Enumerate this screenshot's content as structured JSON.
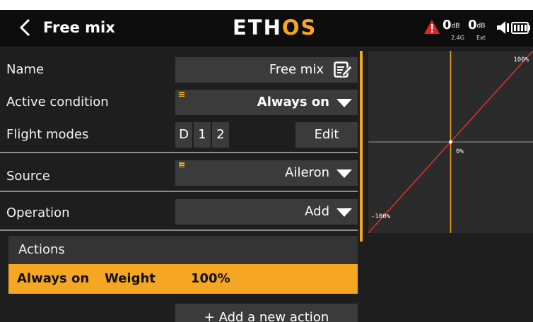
{
  "header": {
    "title": "Free mix",
    "logo_main": "ETH",
    "logo_accent": "OS",
    "rf1_value": "0",
    "rf1_unit": "dB",
    "rf1_band": "2.4G",
    "rf2_value": "0",
    "rf2_unit": "dB",
    "rf2_band": "Ext"
  },
  "form": {
    "name_label": "Name",
    "name_value": "Free mix",
    "active_label": "Active condition",
    "active_value": "Always on",
    "flight_modes_label": "Flight modes",
    "flight_modes": [
      "D",
      "1",
      "2"
    ],
    "edit_label": "Edit",
    "source_label": "Source",
    "source_value": "Aileron",
    "operation_label": "Operation",
    "operation_value": "Add"
  },
  "actions": {
    "header": "Actions",
    "row": {
      "condition": "Always on",
      "weight_label": "Weight",
      "weight_value": "100%"
    },
    "add_label": "+ Add a new action"
  },
  "graph": {
    "top_right_label": "100%",
    "center_label": "0%",
    "left_label": "-100%",
    "curve": {
      "x": [
        -100,
        100
      ],
      "y": [
        -100,
        100
      ]
    },
    "colors": {
      "curve": "#e03030",
      "cursor": "#f5a623",
      "axis": "#9a9a9a"
    }
  },
  "icons": [
    "back-chevron-icon",
    "warning-icon",
    "speaker-icon",
    "battery-icon",
    "edit-icon",
    "menu-icon",
    "dropdown-icon"
  ]
}
